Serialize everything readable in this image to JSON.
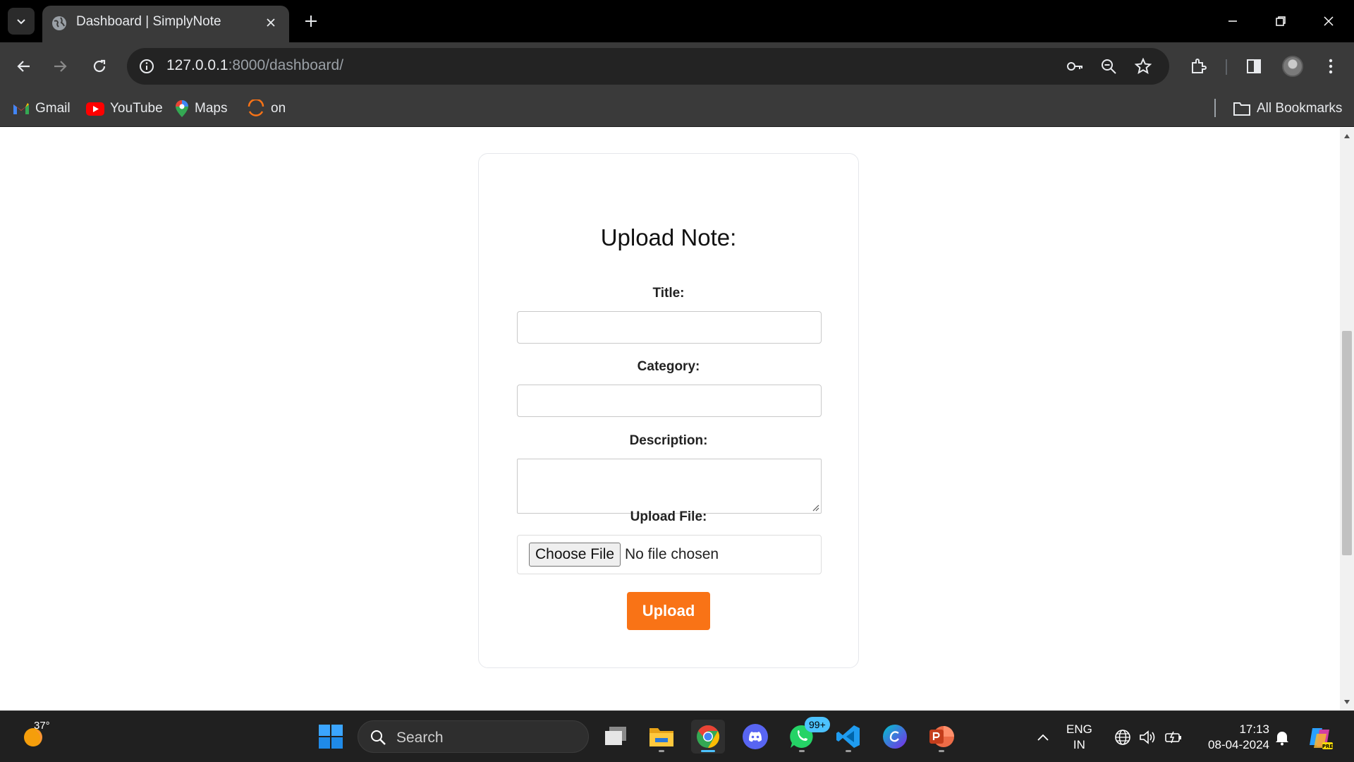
{
  "browser": {
    "tab": {
      "title": "Dashboard | SimplyNote"
    },
    "address": {
      "host": "127.0.0.1",
      "path": ":8000/dashboard/"
    },
    "bookmarks": [
      {
        "label": "Gmail",
        "icon": "gmail-icon"
      },
      {
        "label": "YouTube",
        "icon": "youtube-icon"
      },
      {
        "label": "Maps",
        "icon": "maps-icon"
      },
      {
        "label": "on",
        "icon": "site-icon"
      }
    ],
    "all_bookmarks_label": "All Bookmarks"
  },
  "form": {
    "heading": "Upload Note:",
    "title_label": "Title:",
    "title_value": "",
    "category_label": "Category:",
    "category_value": "",
    "description_label": "Description:",
    "description_value": "",
    "file_label": "Upload File:",
    "file_button": "Choose File",
    "file_status": "No file chosen",
    "submit_label": "Upload",
    "accent_color": "#f97316"
  },
  "taskbar": {
    "weather_temp": "37°",
    "search_label": "Search",
    "whatsapp_badge": "99+",
    "language": "ENG",
    "region": "IN",
    "time": "17:13",
    "date": "08-04-2024",
    "apps": [
      "start-icon",
      "task-view-icon",
      "file-explorer-icon",
      "chrome-icon",
      "discord-icon",
      "whatsapp-icon",
      "vscode-icon",
      "canva-icon",
      "powerpoint-icon"
    ]
  }
}
